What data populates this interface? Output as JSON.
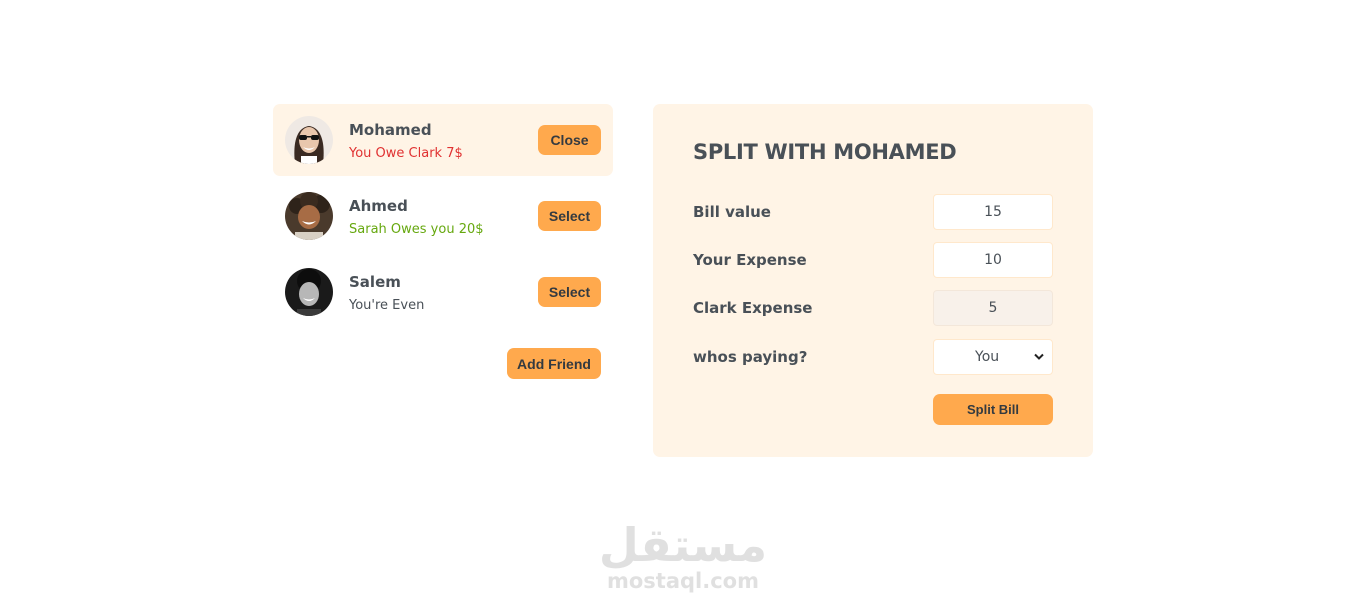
{
  "friends": [
    {
      "name": "Mohamed",
      "status": "You Owe Clark 7$",
      "button": "Close",
      "selected": true,
      "status_color": "#e03131"
    },
    {
      "name": "Ahmed",
      "status": "Sarah Owes you 20$",
      "button": "Select",
      "selected": false,
      "status_color": "#66a80f"
    },
    {
      "name": "Salem",
      "status": "You're Even",
      "button": "Select",
      "selected": false,
      "status_color": "#495057"
    }
  ],
  "add_friend_label": "Add Friend",
  "split_form": {
    "title": "SPLIT WITH MOHAMED",
    "bill_label": "Bill value",
    "bill_value": "15",
    "your_expense_label": "Your Expense",
    "your_expense_value": "10",
    "friend_expense_label": "Clark Expense",
    "friend_expense_value": "5",
    "payer_label": "whos paying?",
    "payer_value": "You",
    "submit_label": "Split Bill"
  },
  "watermark": {
    "arabic": "مستقل",
    "latin": "mostaql.com"
  },
  "colors": {
    "accent": "#ffa94d",
    "panel_bg": "#fff4e6",
    "text": "#495057"
  }
}
